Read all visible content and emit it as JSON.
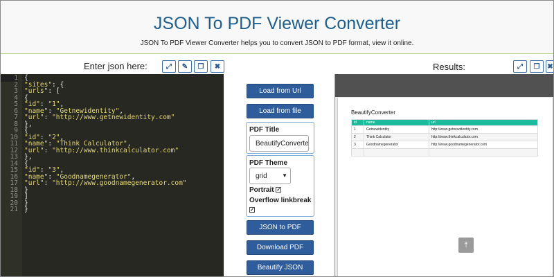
{
  "header": {
    "title": "JSON To PDF Viewer Converter",
    "subtitle": "JSON To PDF Viewer Converter helps you to convert JSON to PDF format, view it online."
  },
  "left_panel": {
    "label": "Enter json here:",
    "icons": [
      "expand-icon",
      "clear-icon",
      "copy-icon",
      "close-icon"
    ]
  },
  "right_panel": {
    "label": "Results:",
    "icons": [
      "expand-icon",
      "copy-icon",
      "close-icon"
    ]
  },
  "editor": {
    "lines": [
      {
        "n": "1",
        "text": "{"
      },
      {
        "n": "2",
        "text": "\"sites\": {"
      },
      {
        "n": "3",
        "text": "\"urls\": ["
      },
      {
        "n": "4",
        "text": "{"
      },
      {
        "n": "5",
        "text": "\"id\": \"1\","
      },
      {
        "n": "6",
        "text": "\"name\": \"Getnewidentity\","
      },
      {
        "n": "7",
        "text": "\"url\": \"http://www.getnewidentity.com\""
      },
      {
        "n": "8",
        "text": "},"
      },
      {
        "n": "9",
        "text": "{"
      },
      {
        "n": "10",
        "text": "\"id\": \"2\","
      },
      {
        "n": "11",
        "text": "\"name\": \"Think Calculator\","
      },
      {
        "n": "12",
        "text": "\"url\": \"http://www.thinkcalculator.com\""
      },
      {
        "n": "13",
        "text": "},"
      },
      {
        "n": "14",
        "text": "{"
      },
      {
        "n": "15",
        "text": "\"id\": \"3\","
      },
      {
        "n": "16",
        "text": "\"name\": \"Goodnamegenerator\","
      },
      {
        "n": "17",
        "text": "\"url\": \"http://www.goodnamegenerator.com\""
      },
      {
        "n": "18",
        "text": "}"
      },
      {
        "n": "19",
        "text": "]"
      },
      {
        "n": "20",
        "text": "}"
      },
      {
        "n": "21",
        "text": "}"
      }
    ]
  },
  "controls": {
    "load_url": "Load from Url",
    "load_file": "Load from file",
    "pdf_title_label": "PDF Title",
    "pdf_title_value": "BeautifyConverter",
    "pdf_theme_label": "PDF Theme",
    "pdf_theme_value": "grid",
    "portrait_label": "Portrait",
    "portrait_checked": true,
    "overflow_label": "Overflow linkbreak",
    "overflow_checked": true,
    "json_to_pdf": "JSON to PDF",
    "download_pdf": "Download PDF",
    "beautify_json": "Beautify JSON"
  },
  "pdf_preview": {
    "title": "BeautifyConverter",
    "columns": [
      "id",
      "name",
      "url"
    ],
    "rows": [
      [
        "1",
        "Getnewidentity",
        "http://www.getnewidentity.com"
      ],
      [
        "2",
        "Think Calculator",
        "http://www.thinkcalculator.com"
      ],
      [
        "3",
        "Goodnamegenerator",
        "http://www.goodnamegenerator.com"
      ],
      [
        "",
        "",
        ""
      ]
    ]
  },
  "colors": {
    "title": "#1d5f8f",
    "button": "#2f5d9c",
    "table_header": "#1abc9c",
    "editor_bg": "#272822"
  }
}
